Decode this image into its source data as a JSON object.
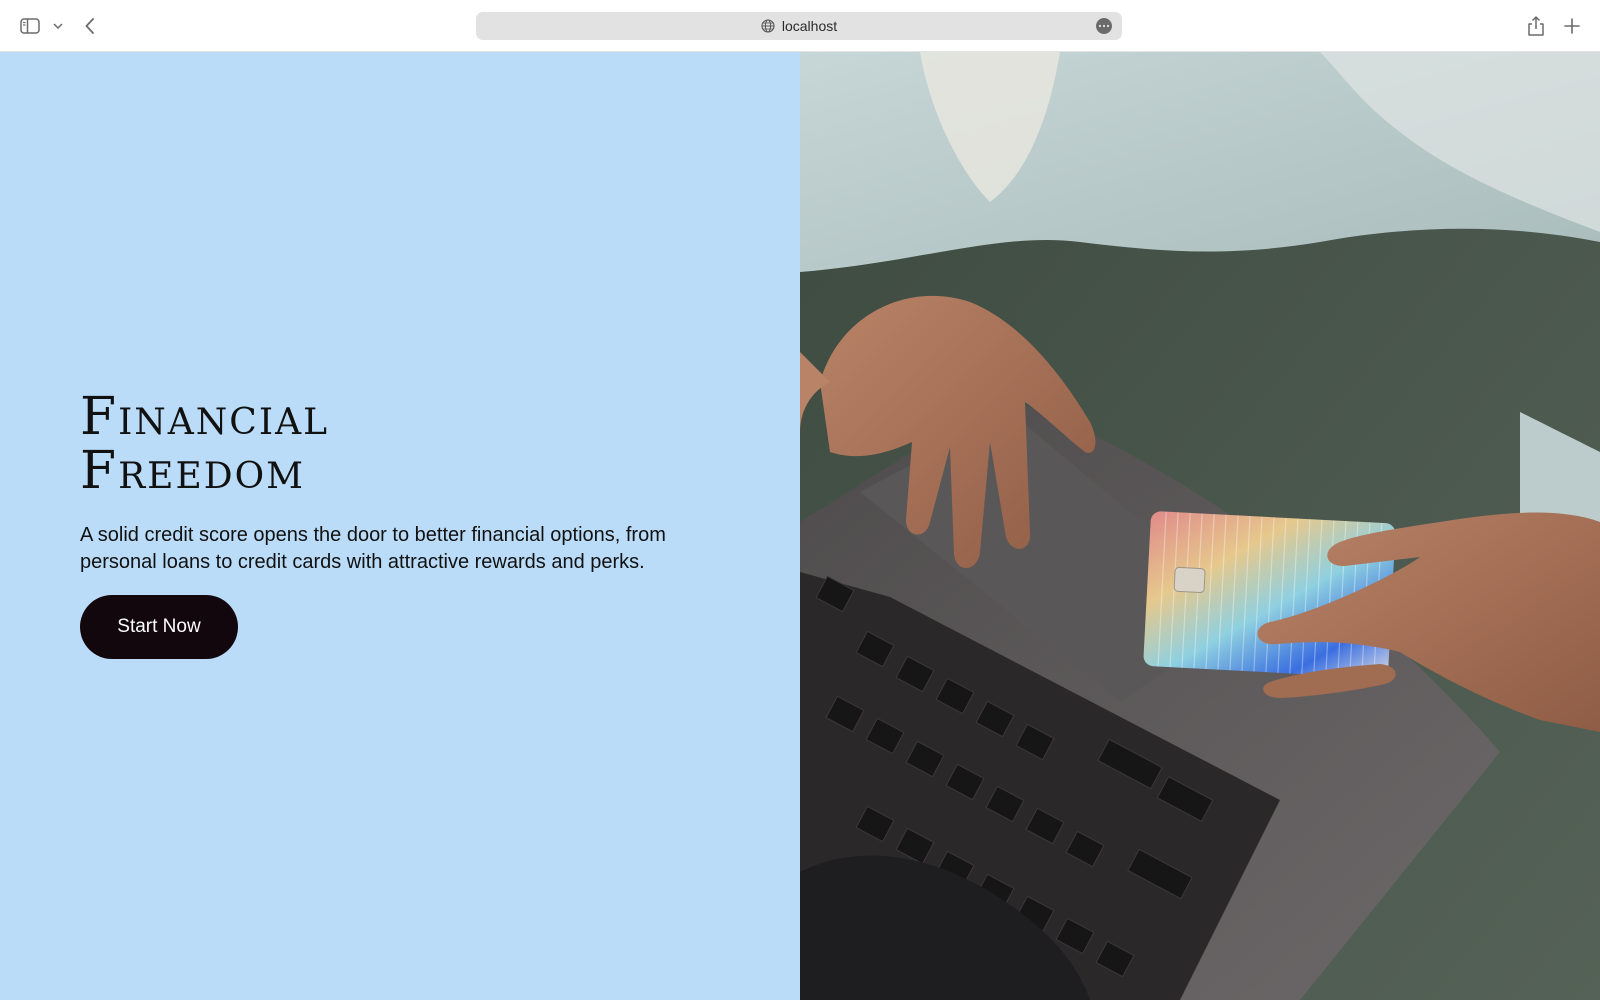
{
  "browser": {
    "url": "localhost",
    "icons": {
      "sidebar": "sidebar-icon",
      "sidebar_menu": "chevron-down-icon",
      "back": "chevron-left-icon",
      "site": "globe-icon",
      "page_menu": "ellipsis-icon",
      "share": "share-icon",
      "new_tab": "plus-icon"
    }
  },
  "hero": {
    "title_line1": "Financial",
    "title_line2": "Freedom",
    "description": "A solid credit score opens the door to better financial options, from personal loans to credit cards with attractive rewards and perks.",
    "cta_label": "Start Now",
    "image": "Hands on a laptop keyboard holding an iridescent credit card"
  },
  "colors": {
    "left_panel_bg": "#badcf8",
    "cta_bg": "#12070c",
    "cta_text": "#ffffff",
    "title_text": "#111111"
  }
}
